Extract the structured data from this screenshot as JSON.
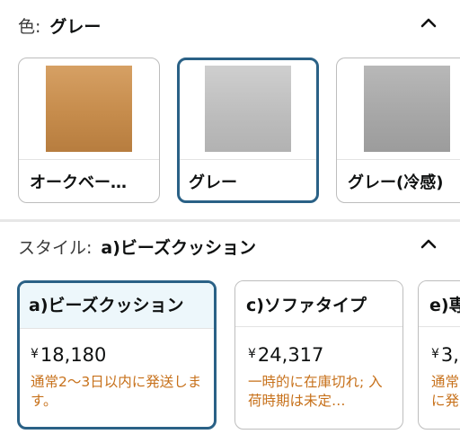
{
  "color_section": {
    "label": "色:",
    "selected": "グレー",
    "options": [
      {
        "label": "オークベー…",
        "swatch": "#c88e4e",
        "selected": false
      },
      {
        "label": "グレー",
        "swatch": "#bfbfbf",
        "selected": true
      },
      {
        "label": "グレー(冷感)",
        "swatch": "#a9a9a9",
        "selected": false
      }
    ]
  },
  "style_section": {
    "label": "スタイル:",
    "selected": "a)ビーズクッション",
    "options": [
      {
        "name": "a)ビーズクッション",
        "currency": "¥",
        "price": "18,180",
        "status": "通常2～3日以内に発送します。",
        "selected": true
      },
      {
        "name": "c)ソファタイプ",
        "currency": "¥",
        "price": "24,317",
        "status": "一時的に在庫切れ; 入荷時期は未定…",
        "selected": false
      },
      {
        "name": "e)専",
        "currency": "¥",
        "price": "3,",
        "status": "通常に発",
        "selected": false
      }
    ]
  },
  "colors": {
    "selected_border": "#2a6186",
    "status_text": "#c7711b",
    "selected_header_bg": "#edf7fb"
  },
  "icons": {
    "collapse": "chevron-up-icon"
  }
}
